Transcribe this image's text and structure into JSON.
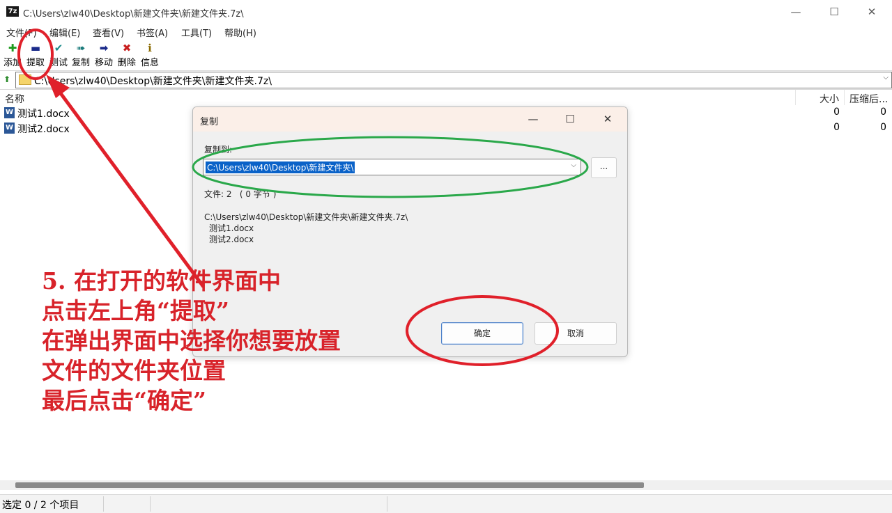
{
  "window": {
    "app_icon_text": "7z",
    "title": "C:\\Users\\zlw40\\Desktop\\新建文件夹\\新建文件夹.7z\\",
    "minimize": "—",
    "maximize": "☐",
    "close": "✕"
  },
  "menu": [
    "文件(F)",
    "编辑(E)",
    "查看(V)",
    "书签(A)",
    "工具(T)",
    "帮助(H)"
  ],
  "toolbar": [
    {
      "label": "添加",
      "icon": "plus-icon",
      "glyph": "✚",
      "color": "#1d9a1d"
    },
    {
      "label": "提取",
      "icon": "minus-icon",
      "glyph": "▬",
      "color": "#1a2a8a"
    },
    {
      "label": "测试",
      "icon": "check-icon",
      "glyph": "✔",
      "color": "#1a8a8a"
    },
    {
      "label": "复制",
      "icon": "copy-arrow-icon",
      "glyph": "➠",
      "color": "#1a7a7a"
    },
    {
      "label": "移动",
      "icon": "move-arrow-icon",
      "glyph": "➡",
      "color": "#1a2a8a"
    },
    {
      "label": "删除",
      "icon": "delete-icon",
      "glyph": "✖",
      "color": "#c81e1e"
    },
    {
      "label": "信息",
      "icon": "info-icon",
      "glyph": "ℹ",
      "color": "#8a6a00"
    }
  ],
  "address": {
    "up_glyph": "⬆",
    "path": "C:\\Users\\zlw40\\Desktop\\新建文件夹\\新建文件夹.7z\\",
    "dropdown_glyph": "⌵"
  },
  "columns": {
    "name": "名称",
    "size": "大小",
    "packed": "压缩后..."
  },
  "files": [
    {
      "name": "测试1.docx",
      "size": "0",
      "packed": "0",
      "icon": "word-doc-icon",
      "icon_text": "W"
    },
    {
      "name": "测试2.docx",
      "size": "0",
      "packed": "0",
      "icon": "word-doc-icon",
      "icon_text": "W"
    }
  ],
  "status": {
    "text": "选定 0 / 2 个项目"
  },
  "dialog": {
    "title": "复制",
    "minimize": "—",
    "maximize": "☐",
    "close": "✕",
    "copy_to_label": "复制到:",
    "destination": "C:\\Users\\zlw40\\Desktop\\新建文件夹\\",
    "dropdown_glyph": "⌵",
    "browse_label": "...",
    "files_info": "文件: 2   ( 0 字节 )",
    "source_path": "C:\\Users\\zlw40\\Desktop\\新建文件夹\\新建文件夹.7z\\",
    "source_files": [
      "测试1.docx",
      "测试2.docx"
    ],
    "ok_label": "确定",
    "cancel_label": "取消"
  },
  "annotation": {
    "color": "#d8232a",
    "lines": [
      "5. 在打开的软件界面中",
      "点击左上角“提取”",
      "在弹出界面中选择你想要放置",
      "文件的文件夹位置",
      "最后点击“确定”"
    ]
  }
}
